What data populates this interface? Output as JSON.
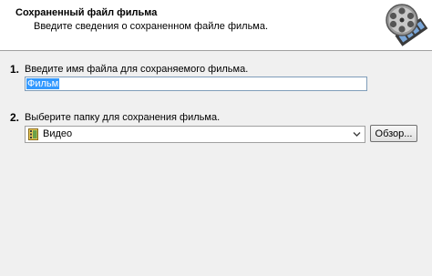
{
  "header": {
    "title": "Сохраненный файл фильма",
    "subtitle": "Введите сведения о сохраненном файле фильма."
  },
  "step1": {
    "number": "1.",
    "label": "Введите имя файла для сохраняемого фильма.",
    "filename_value": "Фильм"
  },
  "step2": {
    "number": "2.",
    "label": "Выберите папку для сохранения фильма.",
    "folder_value": "Видео",
    "browse_label": "Обзор..."
  },
  "icons": {
    "header_icon": "film-reel-icon",
    "folder_icon": "video-folder-icon",
    "dropdown_icon": "chevron-down-icon"
  }
}
